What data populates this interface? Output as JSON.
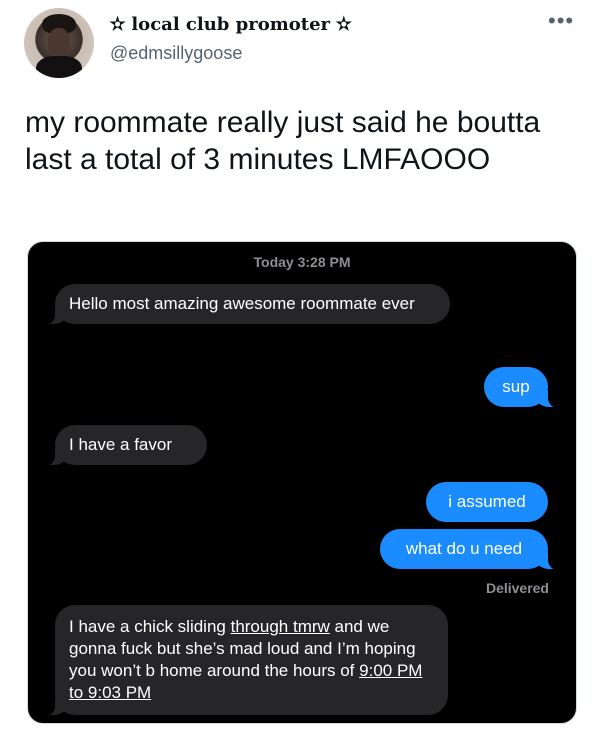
{
  "author": {
    "display_name": "✫ local club promoter ✫",
    "handle": "@edmsillygoose"
  },
  "more_icon": "more-icon",
  "tweet": {
    "text": "my roommate really just said he boutta last a total of 3 minutes LMFAOOO"
  },
  "conversation": {
    "timestamp": "Today 3:28 PM",
    "messages": [
      {
        "from": "them",
        "text": "Hello most amazing awesome roommate ever"
      },
      {
        "from": "me",
        "text": "sup"
      },
      {
        "from": "them",
        "text": "I have a favor"
      },
      {
        "from": "me",
        "text": "i assumed"
      },
      {
        "from": "me",
        "text": "what do u need"
      },
      {
        "from": "them",
        "parts": {
          "p1": "I have a chick sliding ",
          "p2": "through tmrw",
          "p3": " and we gonna fuck but she’s mad loud and I’m hoping you won’t b home around the hours of ",
          "p4": "9:00 PM to 9:03 PM"
        }
      }
    ],
    "status": "Delivered"
  },
  "colors": {
    "incoming_bubble": "#262628",
    "outgoing_bubble": "#1a8cff",
    "meta_text": "#8e8e93"
  }
}
